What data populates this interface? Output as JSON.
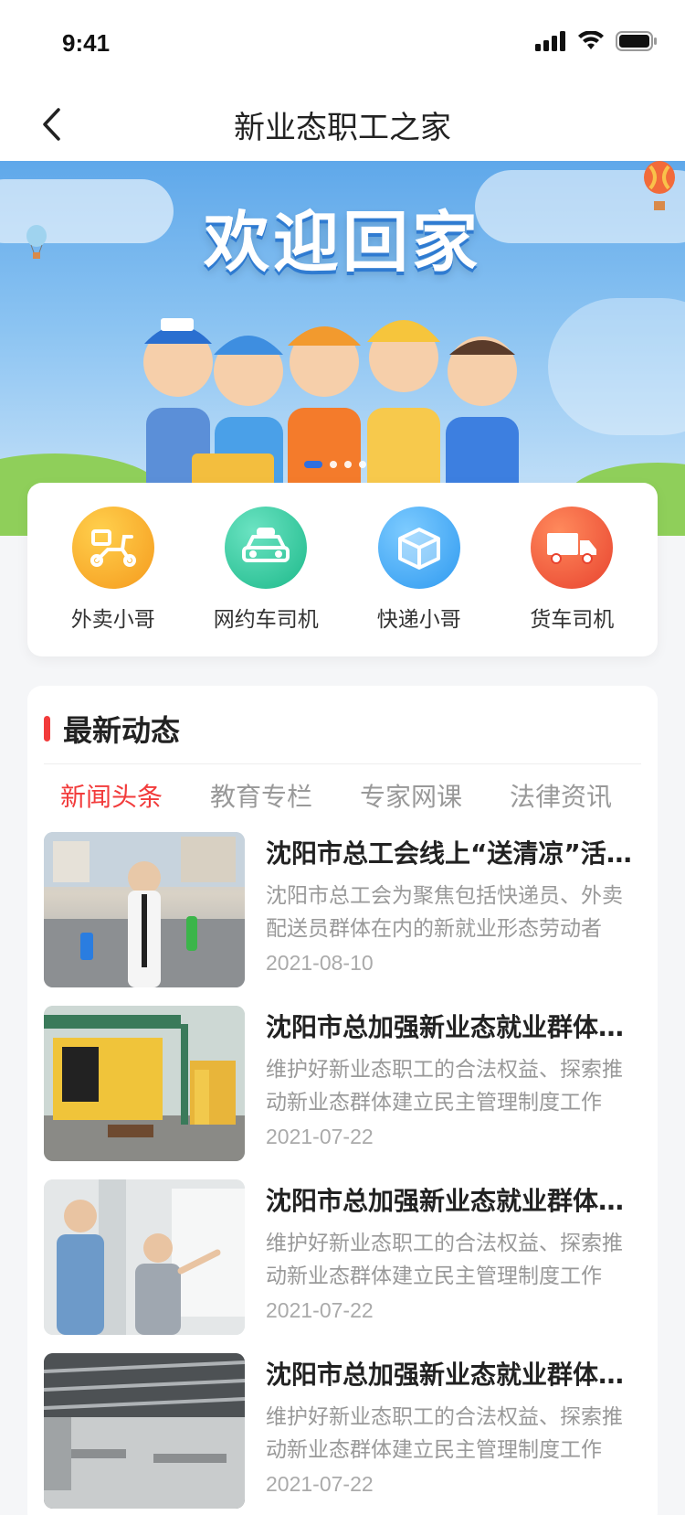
{
  "status": {
    "time": "9:41"
  },
  "nav": {
    "title": "新业态职工之家"
  },
  "banner": {
    "title": "欢迎回家",
    "slides": 4,
    "active_slide": 1
  },
  "categories": [
    {
      "label": "外卖小哥",
      "icon": "scooter-icon",
      "color": "#f7a823"
    },
    {
      "label": "网约车司机",
      "icon": "taxi-icon",
      "color": "#2ecb9a"
    },
    {
      "label": "快递小哥",
      "icon": "package-icon",
      "color": "#3aa8f5"
    },
    {
      "label": "货车司机",
      "icon": "truck-icon",
      "color": "#f0503a"
    }
  ],
  "news": {
    "section_title": "最新动态",
    "tabs": [
      "新闻头条",
      "教育专栏",
      "专家网课",
      "法律资讯"
    ],
    "active_tab": 0,
    "items": [
      {
        "title": "沈阳市总工会线上“送清凉”活动启动",
        "desc": "沈阳市总工会为聚焦包括快递员、外卖配送员群体在内的新就业形态劳动者",
        "date": "2021-08-10"
      },
      {
        "title": "沈阳市总加强新业态就业群体服务工作",
        "desc": "维护好新业态职工的合法权益、探索推动新业态群体建立民主管理制度工作",
        "date": "2021-07-22"
      },
      {
        "title": "沈阳市总加强新业态就业群体服务工作",
        "desc": "维护好新业态职工的合法权益、探索推动新业态群体建立民主管理制度工作",
        "date": "2021-07-22"
      },
      {
        "title": "沈阳市总加强新业态就业群体服务工作",
        "desc": "维护好新业态职工的合法权益、探索推动新业态群体建立民主管理制度工作",
        "date": "2021-07-22"
      }
    ]
  },
  "colors": {
    "accent": "#f23b3b",
    "banner_sky": "#5fa8ea"
  }
}
